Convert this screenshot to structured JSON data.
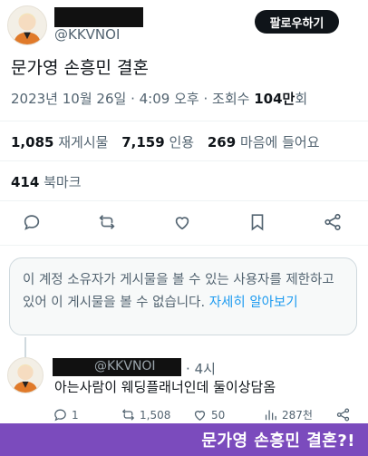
{
  "author": {
    "handle": "@KKVNOI",
    "follow_label": "팔로우하기"
  },
  "post": {
    "text": "문가영 손흥민 결혼",
    "date": "2023년 10월 26일",
    "time": "4:09 오후",
    "views_label": "조회수",
    "views_count": "104만",
    "views_suffix": "회"
  },
  "stats": {
    "reposts_count": "1,085",
    "reposts_label": "재게시물",
    "quotes_count": "7,159",
    "quotes_label": "인용",
    "likes_count": "269",
    "likes_label": "마음에 들어요",
    "bookmarks_count": "414",
    "bookmarks_label": "북마크"
  },
  "actions": [
    "reply-icon",
    "repost-icon",
    "like-icon",
    "bookmark-icon",
    "share-icon"
  ],
  "notice": {
    "text": "이 계정 소유자가 게시물을 볼 수 있는 사용자를 제한하고 있어 이 게시물을 볼 수 없습니다. ",
    "link": "자세히 알아보기"
  },
  "reply": {
    "handle": "@KKVNOI",
    "separator": "·",
    "time": "4시",
    "text": "아는사람이 웨딩플래너인데 둘이상담옴",
    "replies": "1",
    "reposts": "1,508",
    "likes": "50",
    "views": "287천"
  },
  "banner": {
    "text": "문가영 손흥민 결혼?!"
  },
  "colors": {
    "accent": "#1d9bf0",
    "banner": "#7b4bbd",
    "follow_bg": "#0f1419"
  }
}
